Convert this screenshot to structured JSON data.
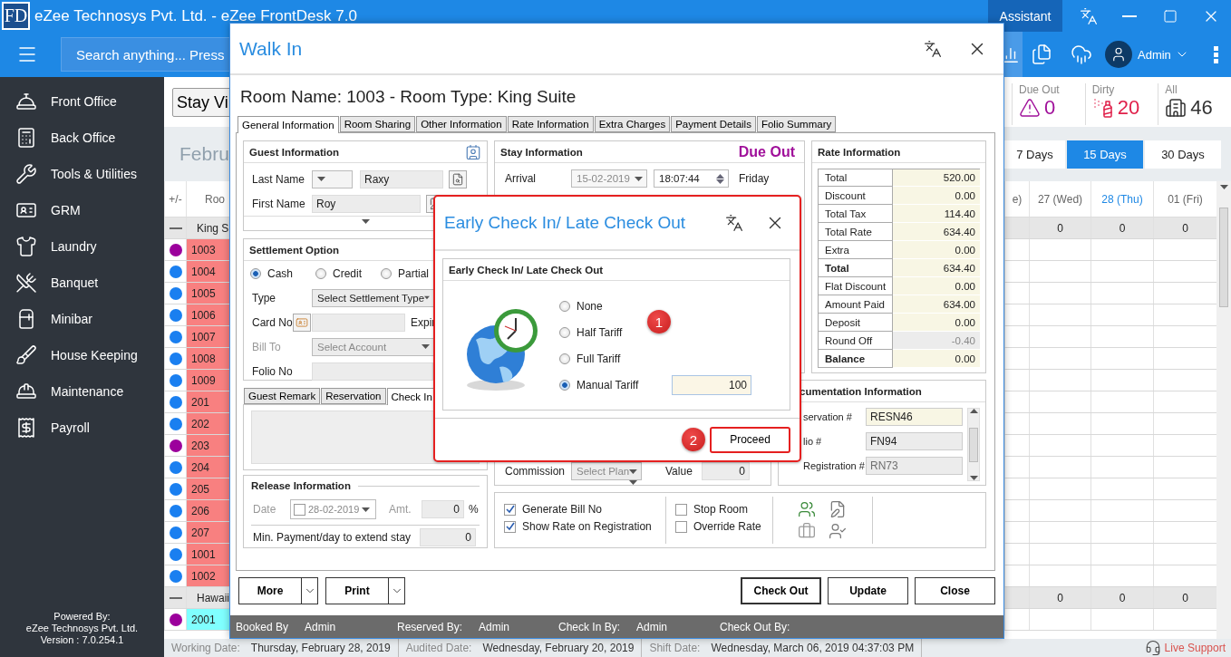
{
  "title_bar": {
    "logo": "FD",
    "title": "eZee Technosys Pvt. Ltd. - eZee FrontDesk 7.0",
    "assistant": "Assistant"
  },
  "top_bar": {
    "search_placeholder": "Search anything... Press",
    "user": "Admin"
  },
  "sidebar": {
    "items": [
      "Front Office",
      "Back Office",
      "Tools & Utilities",
      "GRM",
      "Laundry",
      "Banquet",
      "Minibar",
      "House Keeping",
      "Maintenance",
      "Payroll"
    ],
    "footer": [
      "Powered By:",
      "eZee Technosys Pvt. Ltd.",
      "Version : 7.0.254.1"
    ]
  },
  "view_button": "Stay Vi",
  "month": "Febru",
  "stats": [
    {
      "label": "Due Out",
      "count": "0",
      "color": "#a0109a"
    },
    {
      "label": "Dirty",
      "count": "20",
      "color": "#e0204a"
    },
    {
      "label": "All",
      "count": "46",
      "color": "#333333"
    }
  ],
  "range_tabs": [
    {
      "label": "7 Days",
      "selected": false
    },
    {
      "label": "15 Days",
      "selected": true
    },
    {
      "label": "30 Days",
      "selected": false
    }
  ],
  "grid": {
    "left_columns": [
      "+/-",
      "Roo"
    ],
    "date_columns": [
      {
        "label": "e)",
        "today": false
      },
      {
        "label": "27 (Wed)",
        "today": false
      },
      {
        "label": "28 (Thu)",
        "today": true
      },
      {
        "label": "01 (Fri)",
        "today": false
      }
    ],
    "groups": [
      {
        "name": "King S",
        "expanded": true,
        "color": "#f88080",
        "totals": [
          "0",
          "0",
          "0"
        ],
        "rooms": [
          {
            "number": "1003",
            "color": "#9c009c"
          },
          {
            "number": "1004",
            "color": "#1a7ff0"
          },
          {
            "number": "1005",
            "color": "#1a7ff0"
          },
          {
            "number": "1006",
            "color": "#1a7ff0"
          },
          {
            "number": "1007",
            "color": "#1a7ff0"
          },
          {
            "number": "1008",
            "color": "#1a7ff0"
          },
          {
            "number": "1009",
            "color": "#1a7ff0"
          },
          {
            "number": "201",
            "color": "#1a7ff0"
          },
          {
            "number": "202",
            "color": "#1a7ff0"
          },
          {
            "number": "203",
            "color": "#9c009c"
          },
          {
            "number": "204",
            "color": "#1a7ff0"
          },
          {
            "number": "205",
            "color": "#1a7ff0"
          },
          {
            "number": "206",
            "color": "#1a7ff0"
          },
          {
            "number": "207",
            "color": "#1a7ff0"
          },
          {
            "number": "1001",
            "color": "#1a7ff0"
          },
          {
            "number": "1002",
            "color": "#1a7ff0"
          }
        ]
      },
      {
        "name": "Hawaii",
        "expanded": true,
        "color": "#80ffff",
        "totals": [
          "0",
          "0",
          "0"
        ],
        "rooms": [
          {
            "number": "2001",
            "color": "#9c009c"
          }
        ]
      }
    ]
  },
  "status_bar": {
    "items": [
      {
        "label": "Working Date:",
        "value": "Thursday, February 28, 2019"
      },
      {
        "label": "Audited Date:",
        "value": "Wednesday, February 20, 2019"
      },
      {
        "label": "Shift Date:",
        "value": "Wednesday, March 06, 2019 04:37:03 PM"
      }
    ],
    "live_support": "Live Support"
  },
  "walk_in": {
    "title": "Walk In",
    "heading": "Room Name: 1003 - Room Type: King Suite",
    "tabs": [
      {
        "label": "General Information",
        "selected": true
      },
      {
        "label": "Room Sharing",
        "selected": false
      },
      {
        "label": "Other Information",
        "selected": false
      },
      {
        "label": "Rate Information",
        "selected": false
      },
      {
        "label": "Extra Charges",
        "selected": false
      },
      {
        "label": "Payment Details",
        "selected": false
      },
      {
        "label": "Folio Summary",
        "selected": false
      }
    ],
    "guest": {
      "title": "Guest Information",
      "last_name_label": "Last Name",
      "last_name": "Raxy",
      "first_name_label": "First Name",
      "first_name": "Roy"
    },
    "settlement": {
      "title": "Settlement Option",
      "options": [
        {
          "label": "Cash",
          "selected": true
        },
        {
          "label": "Credit",
          "selected": false
        },
        {
          "label": "Partial",
          "selected": false
        }
      ],
      "type_label": "Type",
      "type_value": "Select Settlement Type",
      "card_label": "Card No",
      "expiry_label": "Expir",
      "bill_to_label": "Bill To",
      "bill_to_value": "Select Account",
      "bill_to_disabled": true,
      "folio_label": "Folio No"
    },
    "remark_tabs": [
      {
        "label": "Guest Remark",
        "selected": false
      },
      {
        "label": "Reservation",
        "selected": false
      },
      {
        "label": "Check In",
        "selected": true
      }
    ],
    "release": {
      "title": "Release Information",
      "date_label": "Date",
      "date": "28-02-2019",
      "checked": false,
      "amt_label": "Amt.",
      "amt": "0",
      "unit": "%",
      "min_payment_label": "Min. Payment/day to extend stay",
      "min_payment": "0"
    },
    "stay": {
      "title": "Stay Information",
      "status": "Due Out",
      "arrival_label": "Arrival",
      "arrival_date": "15-02-2019",
      "arrival_time": "18:07:44",
      "arrival_day": "Friday",
      "commission_label": "Commission",
      "plan": "Select Plan",
      "value_label": "Value",
      "value": "0"
    },
    "rate": {
      "title": "Rate Information",
      "rows": [
        {
          "label": "Total",
          "value": "520.00",
          "bold": false,
          "disabled": false
        },
        {
          "label": "Discount",
          "value": "0.00",
          "bold": false,
          "disabled": false
        },
        {
          "label": "Total Tax",
          "value": "114.40",
          "bold": false,
          "disabled": false
        },
        {
          "label": "Total Rate",
          "value": "634.40",
          "bold": false,
          "disabled": false
        },
        {
          "label": "Extra",
          "value": "0.00",
          "bold": false,
          "disabled": false
        },
        {
          "label": "Total",
          "value": "634.40",
          "bold": true,
          "disabled": false
        },
        {
          "label": "Flat Discount",
          "value": "0.00",
          "bold": false,
          "disabled": false
        },
        {
          "label": "Amount Paid",
          "value": "634.00",
          "bold": false,
          "disabled": false
        },
        {
          "label": "Deposit",
          "value": "0.00",
          "bold": false,
          "disabled": false
        },
        {
          "label": "Round Off",
          "value": "-0.40",
          "bold": false,
          "disabled": true
        },
        {
          "label": "Balance",
          "value": "0.00",
          "bold": true,
          "disabled": false
        }
      ]
    },
    "documentation": {
      "title": "cumentation Information",
      "rows": [
        {
          "label": "servation #",
          "value": "RESN46",
          "kind": "entry"
        },
        {
          "label": "lio #",
          "value": "FN94",
          "kind": "readonly"
        },
        {
          "label": "Registration #",
          "value": "RN73",
          "kind": "disabled"
        }
      ]
    },
    "options": [
      {
        "label": "Generate Bill No",
        "checked": true
      },
      {
        "label": "Show Rate on Registration",
        "checked": true
      },
      {
        "label": "Stop Room",
        "checked": false
      },
      {
        "label": "Override Rate",
        "checked": false
      }
    ],
    "buttons_left": [
      "More",
      "Print"
    ],
    "buttons_right": [
      {
        "label": "Check Out",
        "default": true
      },
      {
        "label": "Update",
        "default": false
      },
      {
        "label": "Close",
        "default": false
      }
    ],
    "footer": [
      {
        "label": "Booked By",
        "value": "Admin"
      },
      {
        "label": "Reserved By:",
        "value": "Admin"
      },
      {
        "label": "Check In By:",
        "value": "Admin"
      },
      {
        "label": "Check Out By:"
      }
    ]
  },
  "early_dialog": {
    "title": "Early Check In/ Late Check Out",
    "group_title": "Early Check In/ Late Check Out",
    "options": [
      {
        "label": "None",
        "selected": false
      },
      {
        "label": "Half Tariff",
        "selected": false
      },
      {
        "label": "Full Tariff",
        "selected": false
      },
      {
        "label": "Manual Tariff",
        "selected": true
      }
    ],
    "manual_value": "100",
    "steps": [
      "1",
      "2"
    ],
    "proceed": "Proceed"
  }
}
